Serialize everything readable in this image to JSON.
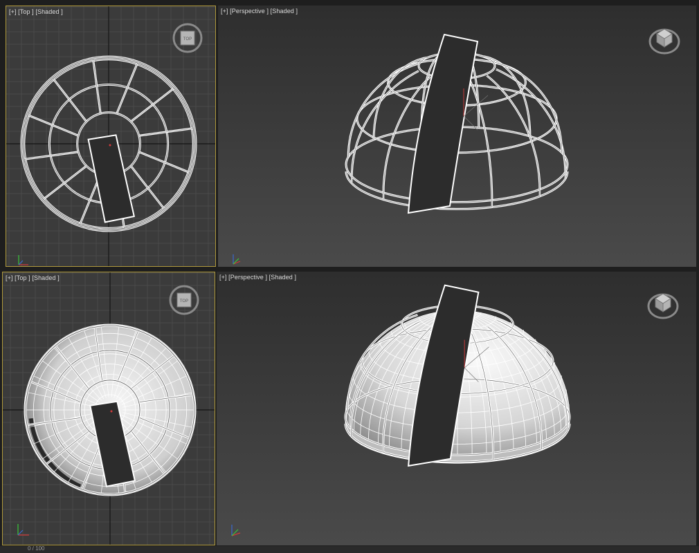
{
  "viewports": [
    {
      "id": "tl",
      "label": "[+] [Top ] [Shaded ]",
      "view": "top",
      "mode": "wire",
      "active": true
    },
    {
      "id": "tr",
      "label": "[+] [Perspective ] [Shaded ]",
      "view": "persp",
      "mode": "wire",
      "active": false
    },
    {
      "id": "bl",
      "label": "[+] [Top ] [Shaded ]",
      "view": "top",
      "mode": "mesh",
      "active": true
    },
    {
      "id": "br",
      "label": "[+] [Perspective ] [Shaded ]",
      "view": "persp",
      "mode": "mesh",
      "active": false
    }
  ],
  "navcube": {
    "top_face_label": "TOP"
  },
  "status": {
    "frame_text": "0 / 100"
  },
  "colors": {
    "viewport_bg": "#3b3b3b",
    "grid_line": "#4a4a4a",
    "grid_major": "#141414",
    "active_border": "#b09a3c",
    "wire": "#ffffff"
  }
}
